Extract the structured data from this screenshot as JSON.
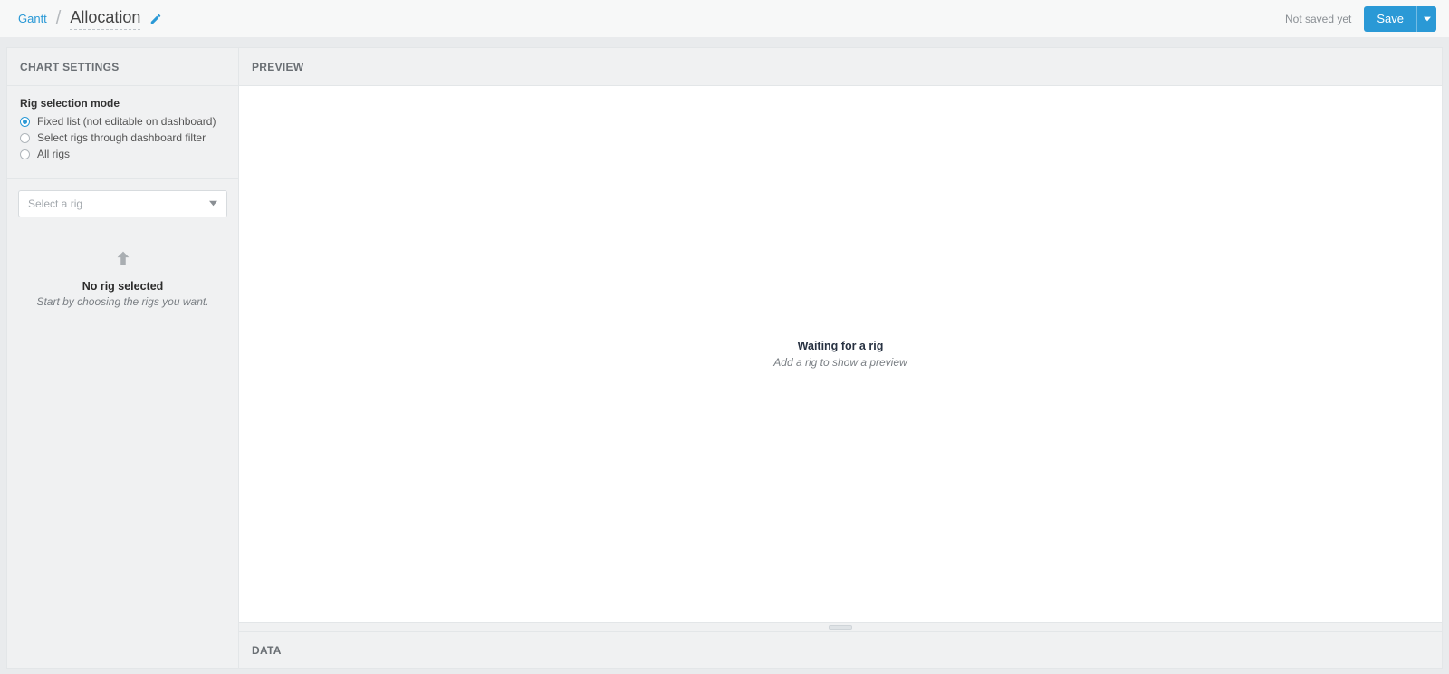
{
  "breadcrumb": {
    "root": "Gantt",
    "title": "Allocation"
  },
  "topbar": {
    "status": "Not saved yet",
    "save_label": "Save"
  },
  "sidebar": {
    "header": "CHART SETTINGS",
    "section_label": "Rig selection mode",
    "radios": {
      "fixed": "Fixed list (not editable on dashboard)",
      "filter": "Select rigs through dashboard filter",
      "all": "All rigs"
    },
    "selected_radio": "fixed",
    "select_placeholder": "Select a rig",
    "empty": {
      "title": "No rig selected",
      "subtitle": "Start by choosing the rigs you want."
    }
  },
  "preview": {
    "header": "PREVIEW",
    "empty_title": "Waiting for a rig",
    "empty_subtitle": "Add a rig to show a preview"
  },
  "data": {
    "header": "DATA"
  }
}
